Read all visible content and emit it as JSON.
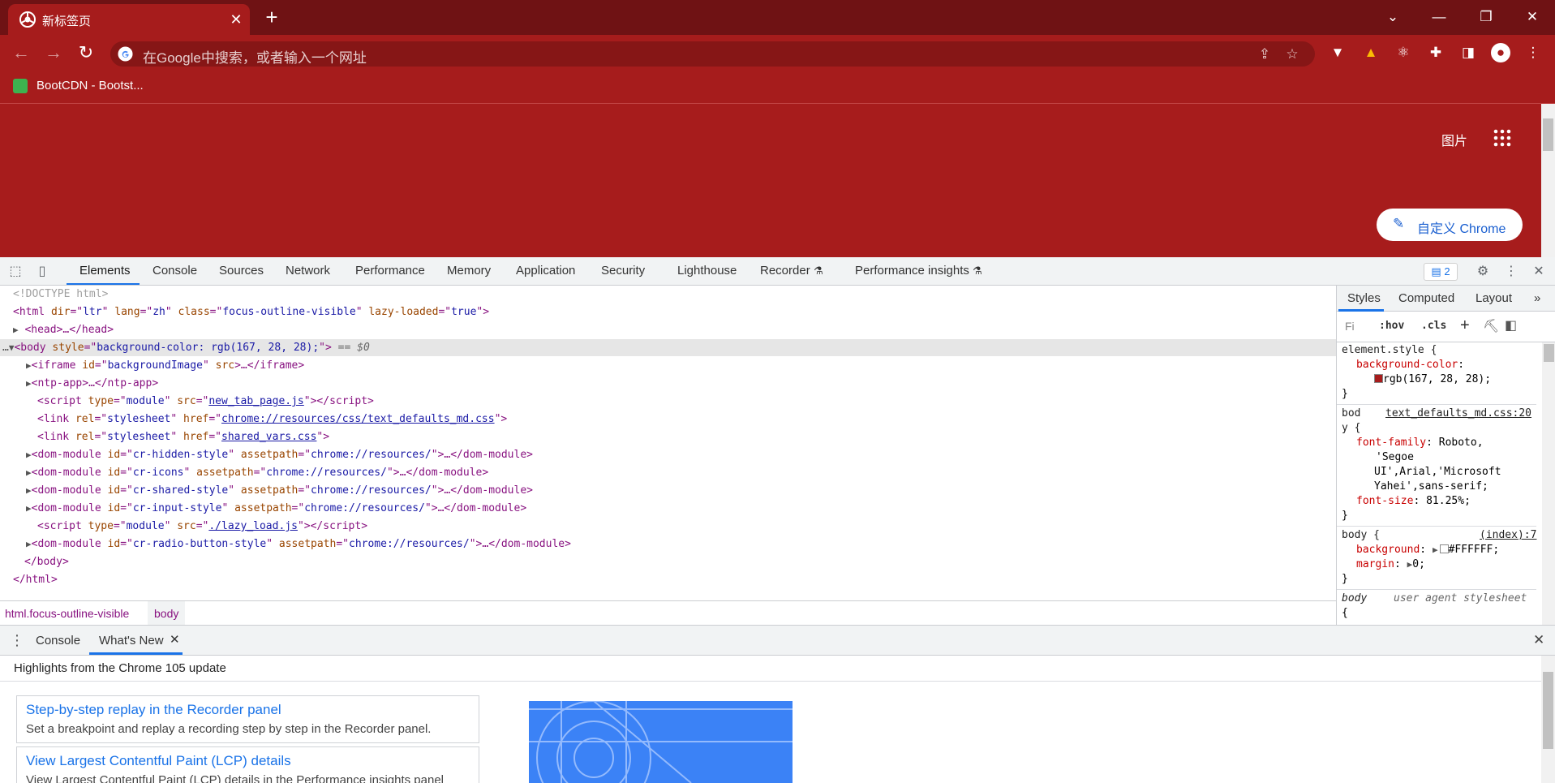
{
  "tab": {
    "title": "新标签页",
    "close": "✕",
    "new": "+"
  },
  "window": {
    "dropdown": "⌄",
    "minimize": "—",
    "restore": "❐",
    "close": "✕"
  },
  "toolbar": {
    "back": "←",
    "forward": "→",
    "reload": "↻",
    "omnibox_placeholder": "在Google中搜索，或者输入一个网址"
  },
  "bookmarks": [
    {
      "label": "BootCDN - Bootst..."
    }
  ],
  "page": {
    "images_link": "图片",
    "customize_button": "自定义 Chrome",
    "background_color": "#a71c1c"
  },
  "devtools": {
    "tabs": [
      "Elements",
      "Console",
      "Sources",
      "Network",
      "Performance",
      "Memory",
      "Application",
      "Security",
      "Lighthouse",
      "Recorder",
      "Performance insights"
    ],
    "issues_count": "2",
    "dom": {
      "doctype": "<!DOCTYPE html>",
      "html_open": [
        "<html ",
        "dir",
        "=\"",
        "ltr",
        "\" ",
        "lang",
        "=\"",
        "zh",
        "\" ",
        "class",
        "=\"",
        "focus-outline-visible",
        "\" ",
        "lazy-loaded",
        "=\"",
        "true",
        "\">"
      ],
      "head": "<head>…</head>",
      "body_open": {
        "tag": "<body ",
        "attr": "style",
        "val": "background-color: rgb(167, 28, 28);",
        "marker": "== $0"
      },
      "iframe": {
        "attr": "id",
        "val": "backgroundImage",
        "attr2": "src"
      },
      "ntp_app": "<ntp-app>…</ntp-app>",
      "script1": {
        "type": "module",
        "src": "new_tab_page.js"
      },
      "link1": {
        "rel": "stylesheet",
        "href": "chrome://resources/css/text_defaults_md.css"
      },
      "link2": {
        "rel": "stylesheet",
        "href": "shared_vars.css"
      },
      "dom_modules": [
        {
          "id": "cr-hidden-style",
          "assetpath": "chrome://resources/"
        },
        {
          "id": "cr-icons",
          "assetpath": "chrome://resources/"
        },
        {
          "id": "cr-shared-style",
          "assetpath": "chrome://resources/"
        },
        {
          "id": "cr-input-style",
          "assetpath": "chrome://resources/"
        }
      ],
      "script2": {
        "type": "module",
        "src": "./lazy_load.js"
      },
      "dom_module_last": {
        "id": "cr-radio-button-style",
        "assetpath": "chrome://resources/"
      },
      "body_close": "</body>",
      "html_close": "</html>"
    },
    "breadcrumb": [
      "html.focus-outline-visible",
      "body"
    ],
    "styles": {
      "tabs": [
        "Styles",
        "Computed",
        "Layout",
        "»"
      ],
      "filter_placeholder": "Fi",
      "hov": ":hov",
      "cls": ".cls",
      "swatch_color": "#a71c1c",
      "rules": {
        "element_style": "element.style {",
        "bg_prop": "background-color",
        "bg_val": "rgb(167, 28, 28);",
        "body_sel_a": "bod",
        "body_sel_b": "y {",
        "body_src": "text_defaults_md.css:20",
        "ff_prop": "font-family",
        "ff_val_1": "Roboto,",
        "ff_val_2": "'Segoe",
        "ff_val_3": "UI',Arial,'Microsoft",
        "ff_val_4": "Yahei',sans-serif;",
        "fs_prop": "font-size",
        "fs_val": "81.25%;",
        "body2_sel": "body {",
        "body2_src": "(index):7",
        "bgd_prop": "background",
        "bgd_val": "#FFFFFF;",
        "margin_prop": "margin",
        "margin_val": "0;",
        "body3_sel": "body",
        "ua": "user agent stylesheet"
      }
    },
    "drawer": {
      "tabs": [
        "Console",
        "What's New"
      ],
      "headline": "Highlights from the Chrome 105 update",
      "features": [
        {
          "title": "Step-by-step replay in the Recorder panel",
          "desc": "Set a breakpoint and replay a recording step by step in the Recorder panel."
        },
        {
          "title": "View Largest Contentful Paint (LCP) details",
          "desc": "View Largest Contentful Paint (LCP) details in the Performance insights panel"
        }
      ]
    }
  }
}
